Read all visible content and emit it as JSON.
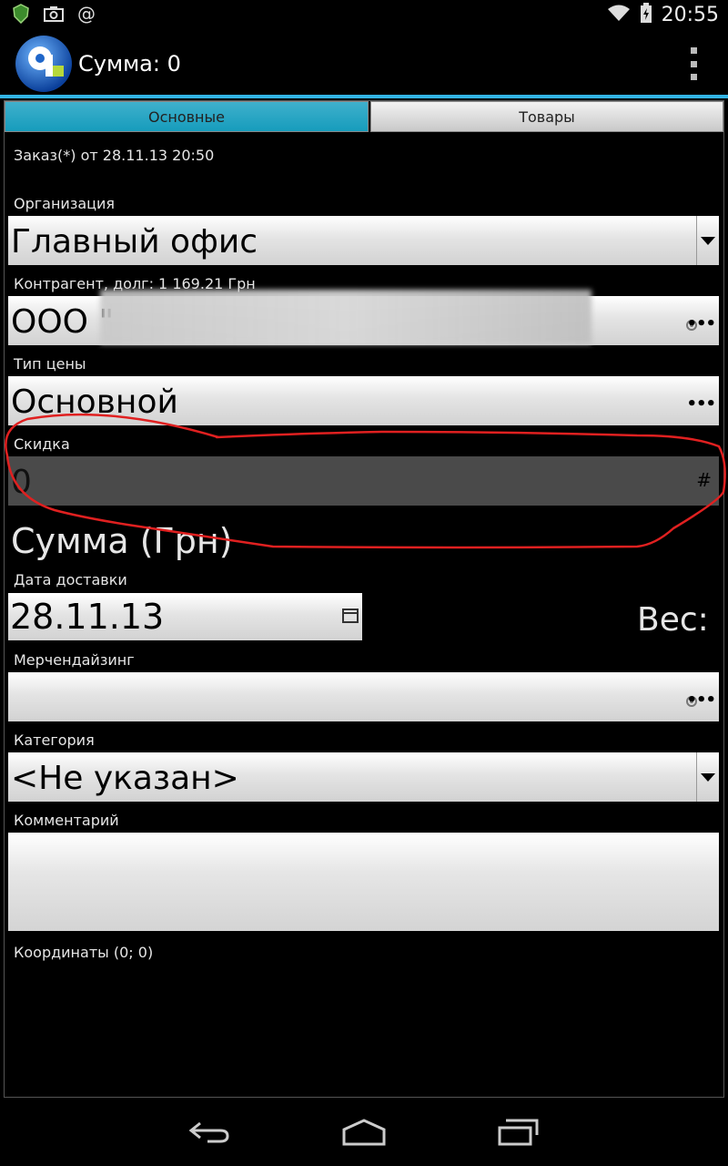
{
  "status_bar": {
    "time": "20:55",
    "left_icons": [
      "android-security-icon",
      "camera-icon",
      "at-icon"
    ],
    "right_icons": [
      "wifi-icon",
      "battery-charging-icon"
    ]
  },
  "action_bar": {
    "title": "Сумма: 0",
    "accent_color": "#33b5e5"
  },
  "tabs": [
    {
      "label": "Основные",
      "selected": true
    },
    {
      "label": "Товары",
      "selected": false
    }
  ],
  "order_header": "Заказ(*) от 28.11.13 20:50",
  "fields": {
    "organization": {
      "label": "Организация",
      "value": "Главный офис"
    },
    "counterparty": {
      "label": "Контрагент, долг: 1 169.21 Грн",
      "value": "ООО \""
    },
    "price_type": {
      "label": "Тип цены",
      "value": "Основной"
    },
    "discount": {
      "label": "Скидка",
      "value": "0"
    },
    "sum_label": "Сумма (Грн)",
    "delivery_date": {
      "label": "Дата доставки",
      "value": "28.11.13"
    },
    "weight_label": "Вес:",
    "merchandising": {
      "label": "Мерчендайзинг",
      "value": ""
    },
    "category": {
      "label": "Категория",
      "value": "<Не указан>"
    },
    "comment": {
      "label": "Комментарий",
      "value": ""
    },
    "coordinates": "Координаты (0; 0)"
  },
  "field_icons": {
    "more": "•••",
    "numeric": "#"
  },
  "annotation_color": "#e02020"
}
